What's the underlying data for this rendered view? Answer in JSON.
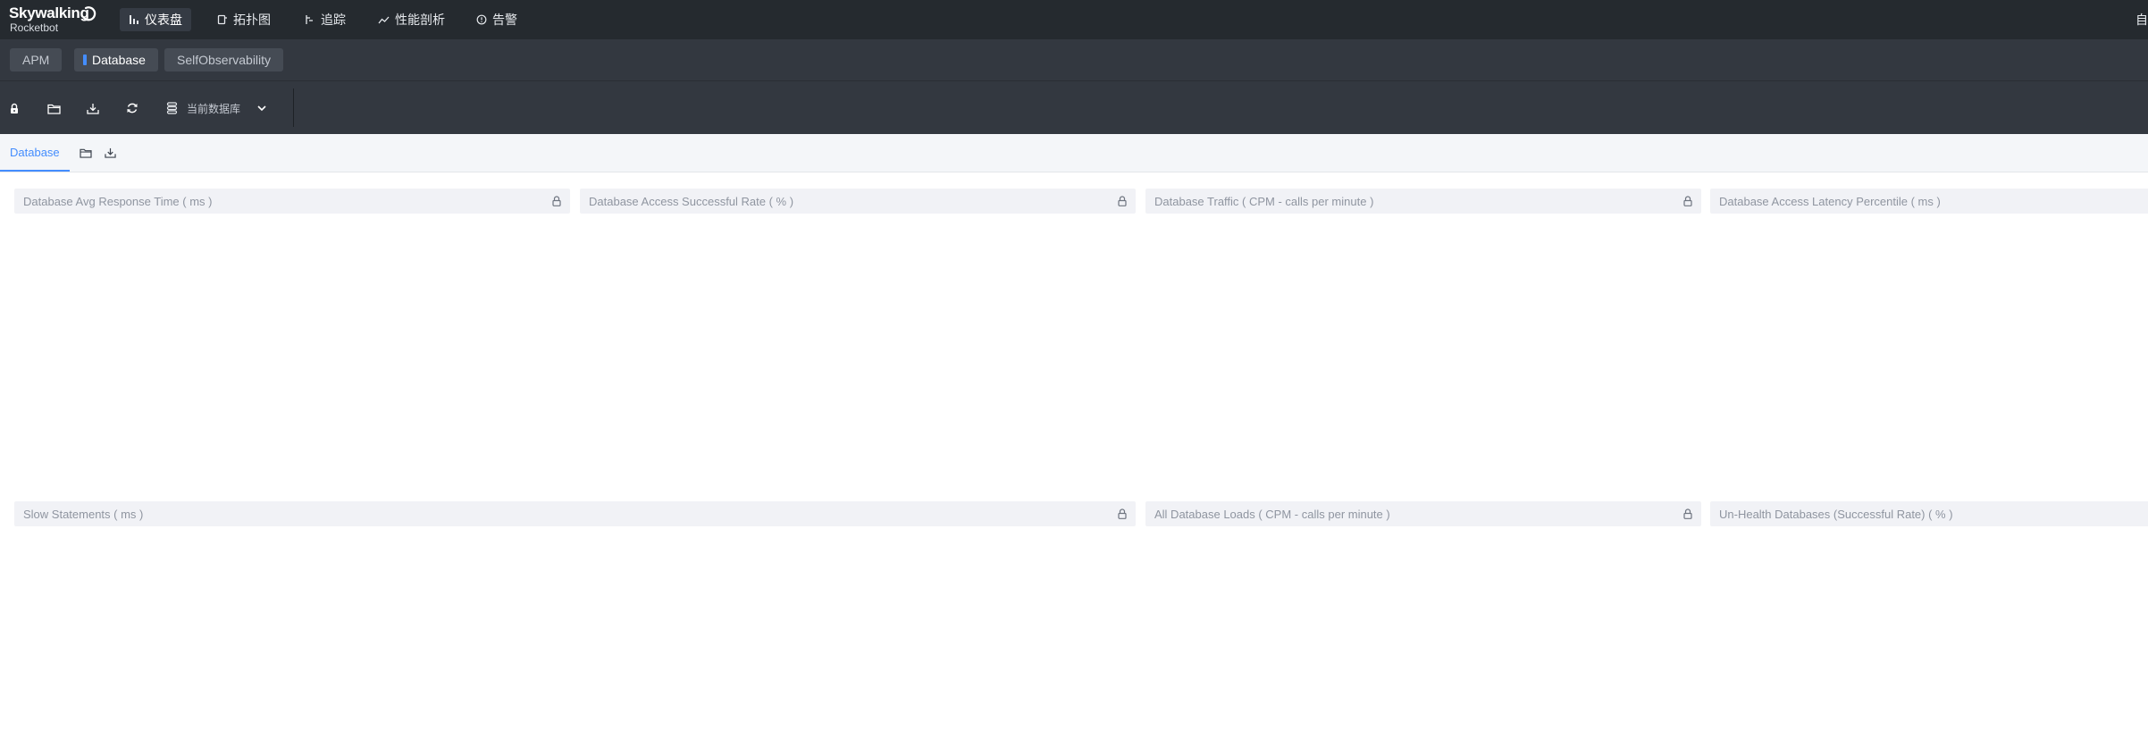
{
  "brand": {
    "name": "Skywalking",
    "subtitle": "Rocketbot"
  },
  "nav": {
    "items": [
      {
        "label": "仪表盘",
        "icon": "dashboard-icon",
        "active": true
      },
      {
        "label": "拓扑图",
        "icon": "topology-icon",
        "active": false
      },
      {
        "label": "追踪",
        "icon": "trace-icon",
        "active": false
      },
      {
        "label": "性能剖析",
        "icon": "profile-icon",
        "active": false
      },
      {
        "label": "告警",
        "icon": "alarm-icon",
        "active": false
      }
    ],
    "right_text": "自"
  },
  "layers": {
    "tabs": [
      {
        "label": "APM",
        "active": false
      },
      {
        "label": "Database",
        "active": true
      },
      {
        "label": "SelfObservability",
        "active": false
      }
    ]
  },
  "toolbar": {
    "buttons": [
      "lock-icon",
      "folder-icon",
      "download-icon",
      "refresh-icon"
    ],
    "database_selector_label": "当前数据库"
  },
  "dashboard": {
    "active_tab": "Database"
  },
  "widgets": {
    "row1": [
      "Database Avg Response Time ( ms )",
      "Database Access Successful Rate ( % )",
      "Database Traffic ( CPM - calls per minute )",
      "Database Access Latency Percentile ( ms )"
    ],
    "row2": [
      "Slow Statements ( ms )",
      "All Database Loads ( CPM - calls per minute )",
      "Un-Health Databases (Successful Rate) ( % )"
    ]
  },
  "colors": {
    "topbar": "#252a2f",
    "toolbar": "#333840",
    "accent": "#448dfe",
    "widget_header": "#f1f2f6"
  }
}
